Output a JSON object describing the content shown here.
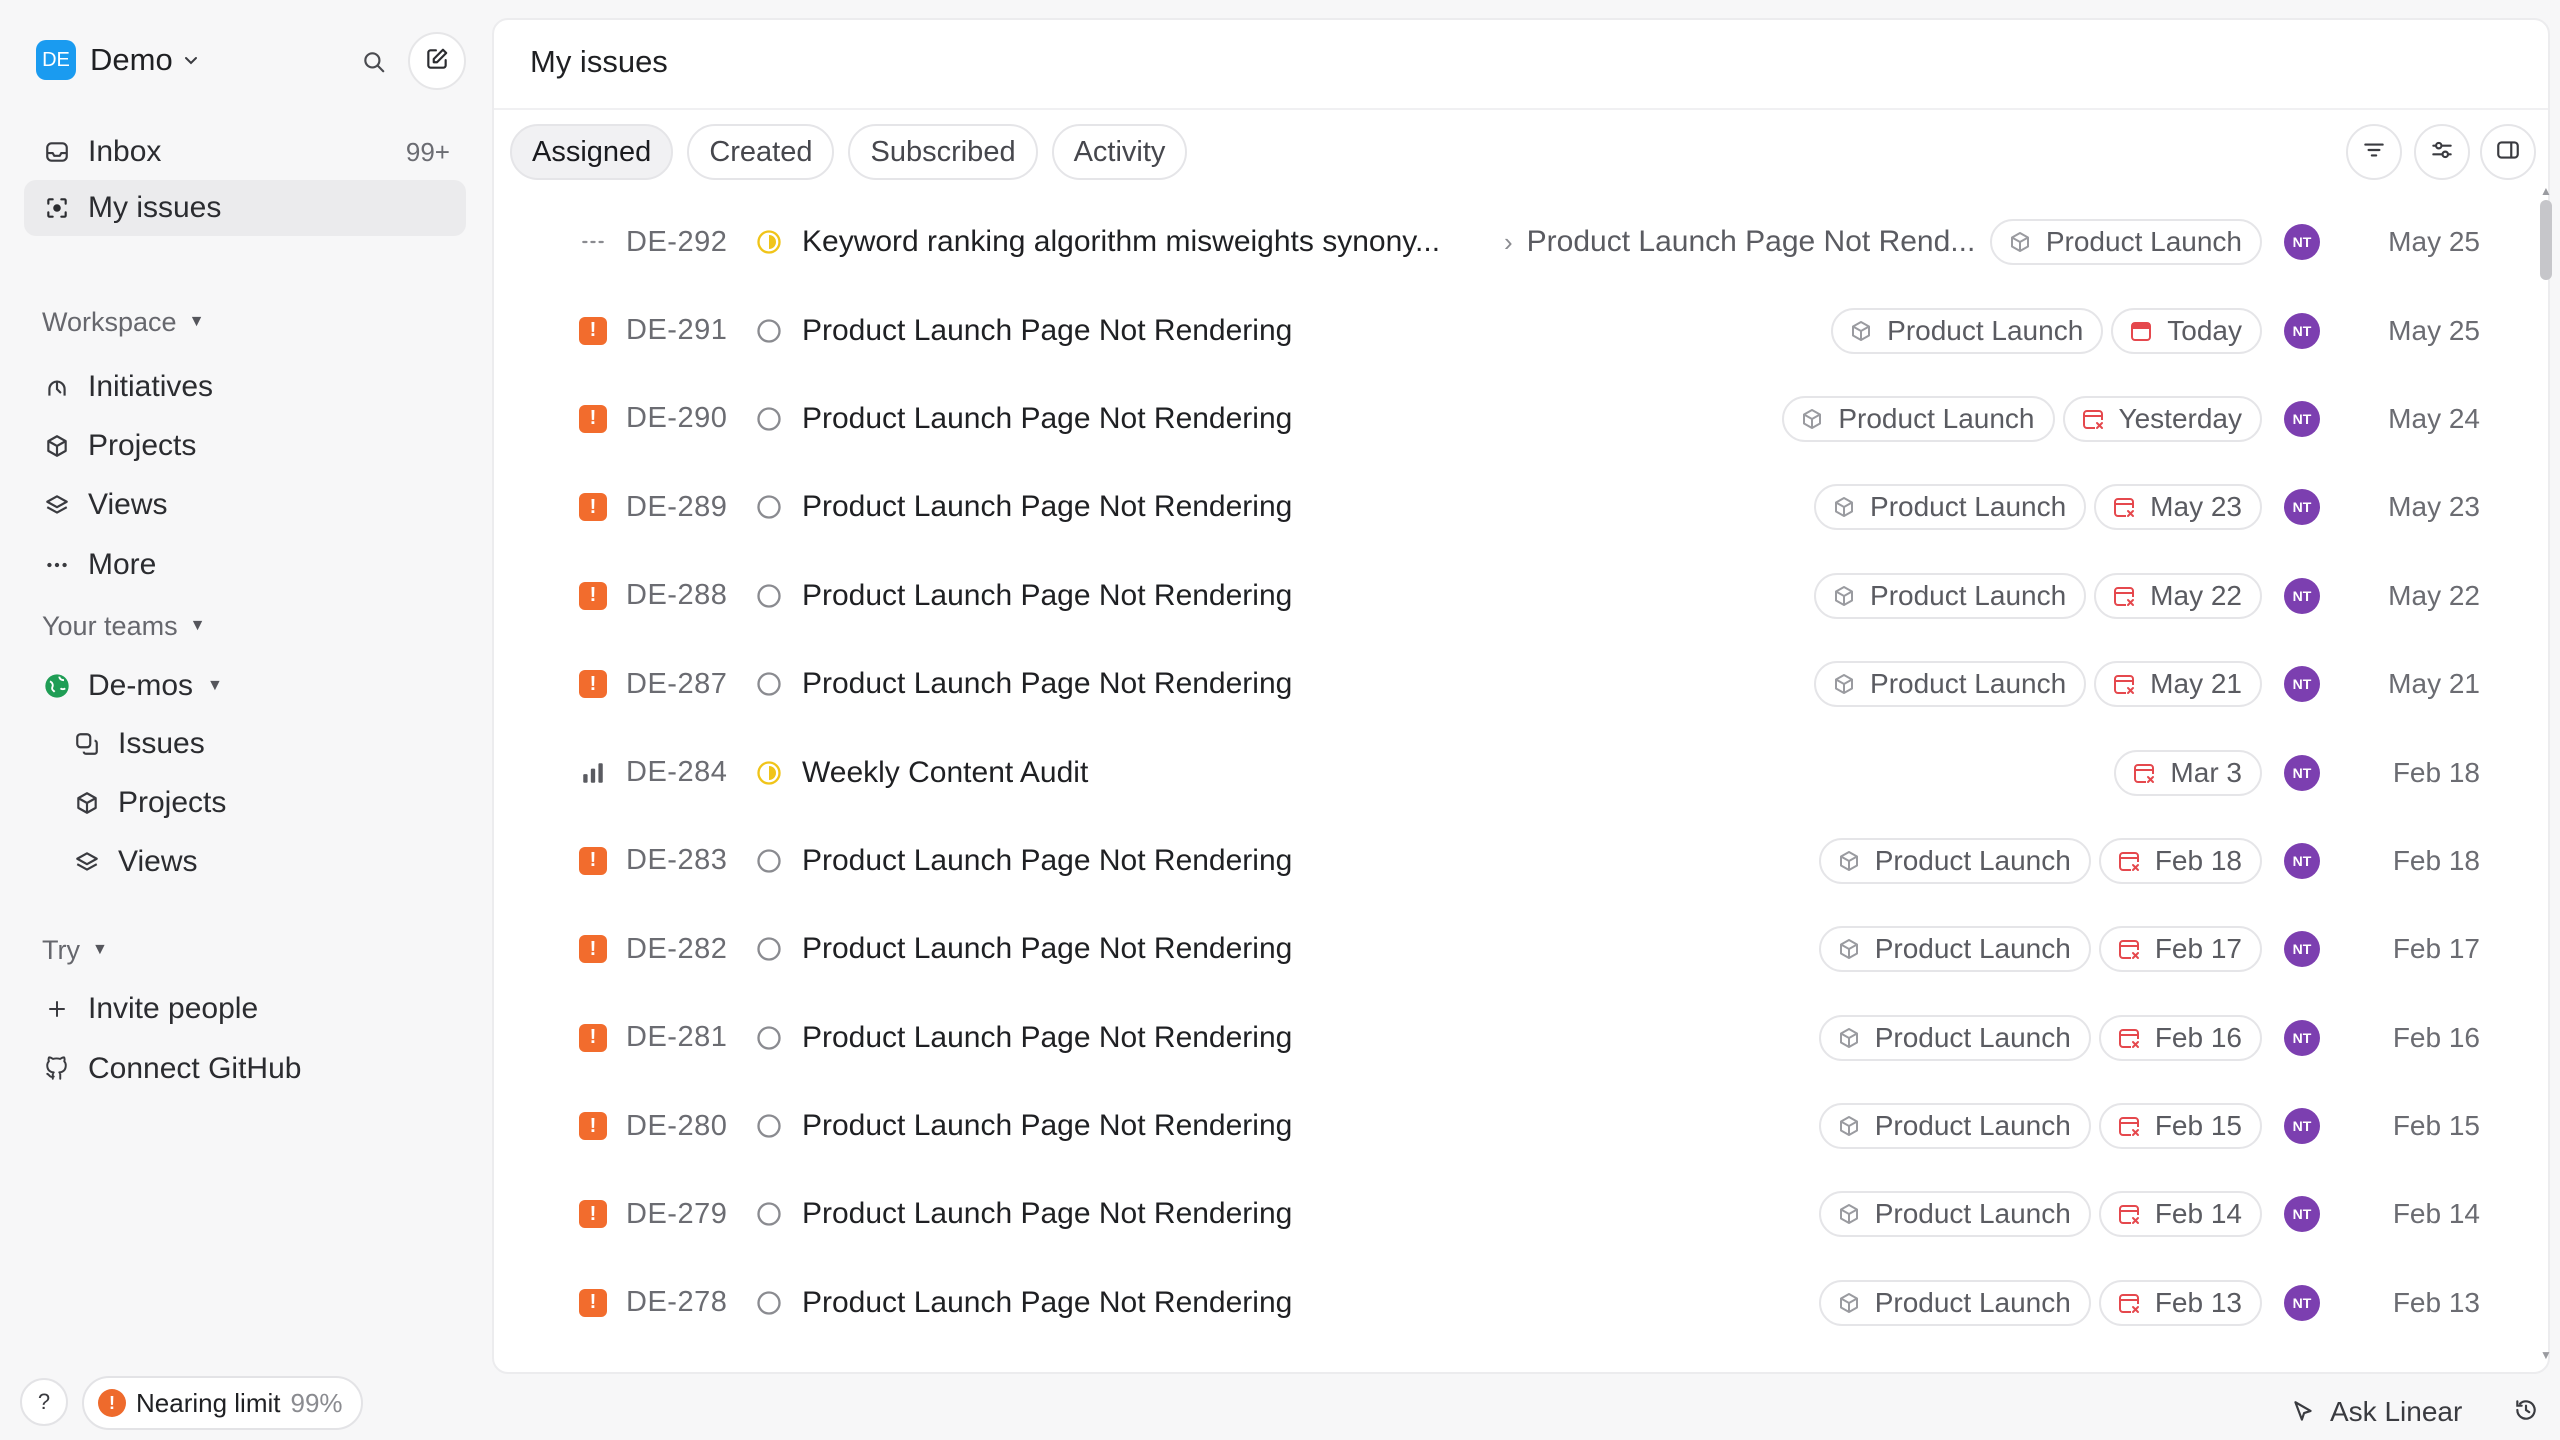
{
  "workspace": {
    "initials": "DE",
    "name": "Demo"
  },
  "sidebar": {
    "inbox": {
      "label": "Inbox",
      "count": "99+"
    },
    "my_issues": {
      "label": "My issues"
    },
    "workspace_section": "Workspace",
    "workspace_items": [
      {
        "label": "Initiatives",
        "icon": "initiatives-icon"
      },
      {
        "label": "Projects",
        "icon": "projects-icon"
      },
      {
        "label": "Views",
        "icon": "views-icon"
      },
      {
        "label": "More",
        "icon": "more-icon"
      }
    ],
    "teams_section": "Your teams",
    "team": {
      "name": "De-mos"
    },
    "team_items": [
      {
        "label": "Issues",
        "icon": "issues-icon"
      },
      {
        "label": "Projects",
        "icon": "projects-icon"
      },
      {
        "label": "Views",
        "icon": "views-icon"
      }
    ],
    "try_section": "Try",
    "try_items": [
      {
        "label": "Invite people",
        "icon": "plus-icon"
      },
      {
        "label": "Connect GitHub",
        "icon": "github-icon"
      }
    ],
    "help_label": "?",
    "limit": {
      "label": "Nearing limit",
      "percent": "99%"
    }
  },
  "main": {
    "title": "My issues",
    "tabs": [
      {
        "label": "Assigned",
        "active": true
      },
      {
        "label": "Created",
        "active": false
      },
      {
        "label": "Subscribed",
        "active": false
      },
      {
        "label": "Activity",
        "active": false
      }
    ],
    "issues": [
      {
        "id": "DE-292",
        "priority": "none",
        "status": "in-progress",
        "title": "Keyword ranking algorithm misweights synony...",
        "parent": "Product Launch Page Not Rend...",
        "project": "Product Launch",
        "due": "",
        "due_type": "",
        "assignee": "NT",
        "date": "May 25"
      },
      {
        "id": "DE-291",
        "priority": "urgent",
        "status": "todo",
        "title": "Product Launch Page Not Rendering",
        "parent": "",
        "project": "Product Launch",
        "due": "Today",
        "due_type": "today",
        "assignee": "NT",
        "date": "May 25"
      },
      {
        "id": "DE-290",
        "priority": "urgent",
        "status": "todo",
        "title": "Product Launch Page Not Rendering",
        "parent": "",
        "project": "Product Launch",
        "due": "Yesterday",
        "due_type": "overdue",
        "assignee": "NT",
        "date": "May 24"
      },
      {
        "id": "DE-289",
        "priority": "urgent",
        "status": "todo",
        "title": "Product Launch Page Not Rendering",
        "parent": "",
        "project": "Product Launch",
        "due": "May 23",
        "due_type": "overdue",
        "assignee": "NT",
        "date": "May 23"
      },
      {
        "id": "DE-288",
        "priority": "urgent",
        "status": "todo",
        "title": "Product Launch Page Not Rendering",
        "parent": "",
        "project": "Product Launch",
        "due": "May 22",
        "due_type": "overdue",
        "assignee": "NT",
        "date": "May 22"
      },
      {
        "id": "DE-287",
        "priority": "urgent",
        "status": "todo",
        "title": "Product Launch Page Not Rendering",
        "parent": "",
        "project": "Product Launch",
        "due": "May 21",
        "due_type": "overdue",
        "assignee": "NT",
        "date": "May 21"
      },
      {
        "id": "DE-284",
        "priority": "high",
        "status": "in-progress",
        "title": "Weekly Content Audit",
        "parent": "",
        "project": "",
        "due": "Mar 3",
        "due_type": "overdue",
        "assignee": "NT",
        "date": "Feb 18"
      },
      {
        "id": "DE-283",
        "priority": "urgent",
        "status": "todo",
        "title": "Product Launch Page Not Rendering",
        "parent": "",
        "project": "Product Launch",
        "due": "Feb 18",
        "due_type": "overdue",
        "assignee": "NT",
        "date": "Feb 18"
      },
      {
        "id": "DE-282",
        "priority": "urgent",
        "status": "todo",
        "title": "Product Launch Page Not Rendering",
        "parent": "",
        "project": "Product Launch",
        "due": "Feb 17",
        "due_type": "overdue",
        "assignee": "NT",
        "date": "Feb 17"
      },
      {
        "id": "DE-281",
        "priority": "urgent",
        "status": "todo",
        "title": "Product Launch Page Not Rendering",
        "parent": "",
        "project": "Product Launch",
        "due": "Feb 16",
        "due_type": "overdue",
        "assignee": "NT",
        "date": "Feb 16"
      },
      {
        "id": "DE-280",
        "priority": "urgent",
        "status": "todo",
        "title": "Product Launch Page Not Rendering",
        "parent": "",
        "project": "Product Launch",
        "due": "Feb 15",
        "due_type": "overdue",
        "assignee": "NT",
        "date": "Feb 15"
      },
      {
        "id": "DE-279",
        "priority": "urgent",
        "status": "todo",
        "title": "Product Launch Page Not Rendering",
        "parent": "",
        "project": "Product Launch",
        "due": "Feb 14",
        "due_type": "overdue",
        "assignee": "NT",
        "date": "Feb 14"
      },
      {
        "id": "DE-278",
        "priority": "urgent",
        "status": "todo",
        "title": "Product Launch Page Not Rendering",
        "parent": "",
        "project": "Product Launch",
        "due": "Feb 13",
        "due_type": "overdue",
        "assignee": "NT",
        "date": "Feb 13"
      }
    ]
  },
  "footer": {
    "ask_label": "Ask Linear"
  },
  "colors": {
    "accent": "#1a9bf0",
    "urgent": "#f26c2d",
    "in_progress": "#f0c419",
    "overdue": "#e5484d",
    "assignee": "#7c3fb0",
    "team": "#1f9d55"
  }
}
